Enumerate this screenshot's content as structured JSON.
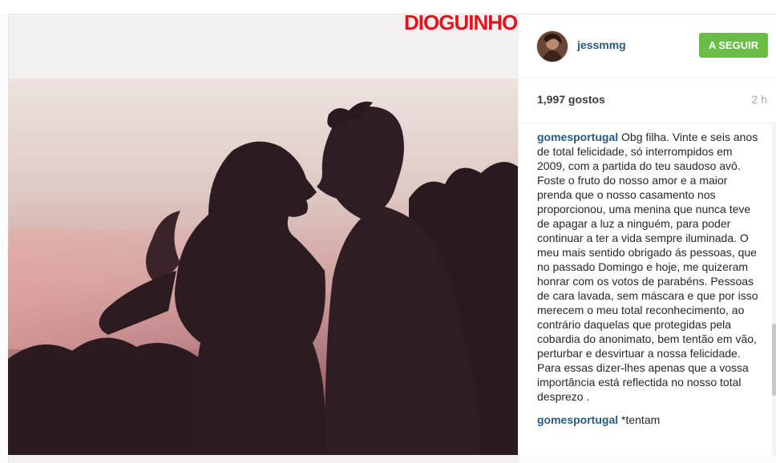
{
  "watermark": "DIOGUINHO.PT",
  "post": {
    "username": "jessmmg",
    "follow_label": "A SEGUIR",
    "likes": "1,997 gostos",
    "time_ago": "2 h"
  },
  "comments": [
    {
      "author": "gomesportugal",
      "text": "Obg filha. Vinte e seis anos de total felicidade, só interrompidos em 2009, com a partida do teu saudoso avô. Foste o fruto do nosso amor e a maior prenda que o nosso casamento nos proporcionou, uma menina que nunca teve de apagar a luz a ninguém, para poder continuar a ter a vida sempre iluminada. O meu mais sentido obrigado ás pessoas, que no passado Domingo e hoje, me quizeram honrar com os votos de parabéns. Pessoas de cara lavada, sem máscara e que por isso merecem o meu total reconhecimento, ao contrário daquelas que protegidas pela cobardia do anonimato, bem tentão em vão, perturbar e desvirtuar a nossa felicidade. Para essas dizer-lhes apenas que a vossa importância está reflectida no nosso total desprezo ."
    },
    {
      "author": "gomesportugal",
      "text": "*tentam"
    }
  ],
  "colors": {
    "follow_button": "#6bbc45",
    "username": "#2a5a80",
    "watermark": "#e4141c"
  },
  "icons": [
    "avatar-photo"
  ]
}
